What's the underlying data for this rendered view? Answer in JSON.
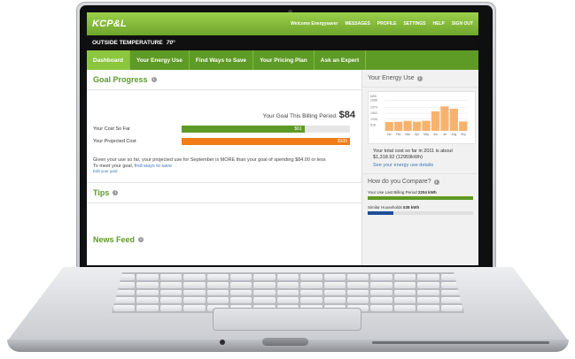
{
  "app": {
    "logo": "KCP&L",
    "top_nav": [
      "Welcome Energysaver",
      "MESSAGES",
      "PROFILE",
      "SETTINGS",
      "HELP",
      "SIGN OUT"
    ],
    "temperature": {
      "label": "OUTSIDE TEMPERATURE",
      "value": "70°"
    },
    "tabs": [
      "Dashboard",
      "Your Energy Use",
      "Find Ways to Save",
      "Your Pricing Plan",
      "Ask an Expert"
    ],
    "active_tab": 0
  },
  "goal": {
    "title": "Goal Progress",
    "goal_text": "Your Goal This Billing Period:",
    "goal_value": "$84",
    "rows": [
      {
        "label": "Your Cost So Far",
        "value": "$61",
        "fraction": 0.73,
        "color": "#5e9a26"
      },
      {
        "label": "Your Projected Cost",
        "value": "$105",
        "fraction": 1.0,
        "color": "#f07d17"
      }
    ],
    "message": "Given your use so far, your projected use for September is MORE than your goal of spending $84.00 or less",
    "meet_prefix": "To meet your goal, ",
    "meet_link": "find ways to save",
    "edit_link": "Edit your goal"
  },
  "tips": {
    "title": "Tips"
  },
  "news": {
    "title": "News Feed"
  },
  "energy": {
    "title": "Your Energy Use",
    "unit": "kWh",
    "total": "Your total cost so far in 2011 is about $1,318.92 (12959kWh)",
    "details_link": "See your energy use details"
  },
  "compare": {
    "title": "How do you Compare?",
    "items": [
      {
        "label": "Your Use Last Billing Period",
        "value": "2204 kWh",
        "fraction": 1.0,
        "color": "#5e9a26"
      },
      {
        "label": "Similar Households",
        "value": "538 kWh",
        "fraction": 0.24,
        "color": "#1f4e99"
      }
    ]
  },
  "chart_data": {
    "type": "bar",
    "categories": [
      "Jan",
      "Feb",
      "Mar",
      "Apr",
      "May",
      "Jun",
      "Jul",
      "Aug",
      "Sep"
    ],
    "values": [
      775,
      800,
      880,
      810,
      885,
      1720,
      2150,
      1950,
      830
    ],
    "ylabel": "kWh",
    "yticks": [
      2688,
      2070,
      1553,
      1035,
      518
    ],
    "ylim": [
      0,
      2800
    ],
    "series_colors": [
      "#f7b36e"
    ]
  }
}
